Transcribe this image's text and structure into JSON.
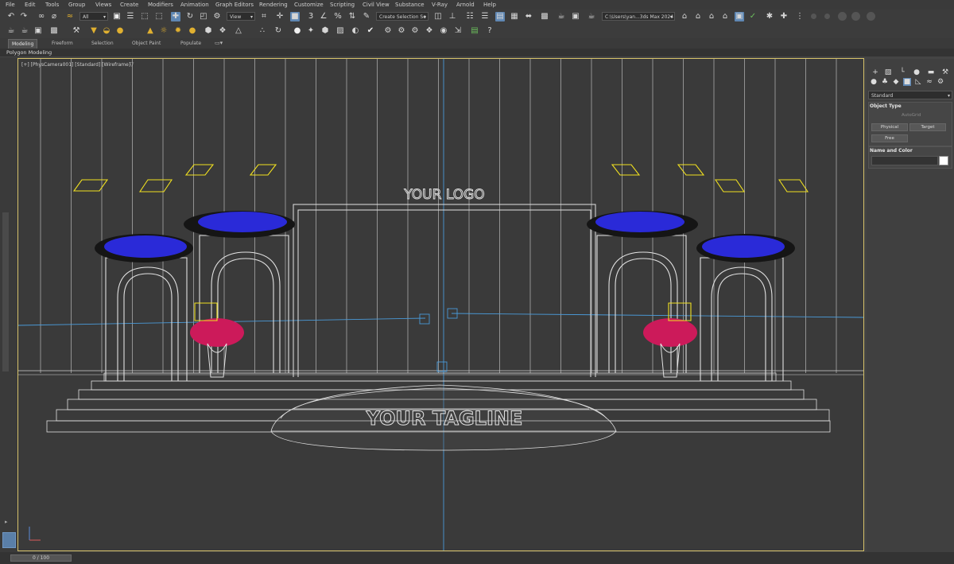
{
  "menu": {
    "items": [
      "File",
      "Edit",
      "Tools",
      "Group",
      "Views",
      "Create",
      "Modifiers",
      "Animation",
      "Graph Editors",
      "Rendering",
      "Customize",
      "Scripting",
      "Civil View",
      "Substance",
      "V-Ray",
      "Arnold",
      "Help"
    ]
  },
  "toolbar": {
    "selection_filter": "All",
    "reference_coord": "View",
    "named_selection": "Create Selection Se",
    "workspace_path": "C:\\Users\\yan...3ds Max 2024"
  },
  "ribbon": {
    "tabs": [
      "Modeling",
      "Freeform",
      "Selection",
      "Object Paint",
      "Populate"
    ],
    "active_tab": "Modeling",
    "sub_label": "Polygon Modeling"
  },
  "viewport": {
    "label": "[+] [PhysCamera001] [Standard] [Wireframe]",
    "filter_icon": "funnel-icon",
    "scene_logo": "YOUR LOGO",
    "scene_tagline": "YOUR TAGLINE",
    "colors": {
      "wire": "#e2e2e2",
      "camera_line": "#4a9ad8",
      "lights": "#f0e020",
      "flowers_blue": "#2a2ad8",
      "flowers_dark": "#151515",
      "vase_flowers": "#cc1a5a"
    }
  },
  "command_panel": {
    "category_dropdown": "Standard",
    "object_type_header": "Object Type",
    "autogrid_label": "AutoGrid",
    "buttons": [
      "Physical",
      "Target",
      "Free"
    ],
    "name_color_header": "Name and Color",
    "swatch_color": "#ffffff"
  },
  "timeline": {
    "frame_label": "0 / 100"
  }
}
